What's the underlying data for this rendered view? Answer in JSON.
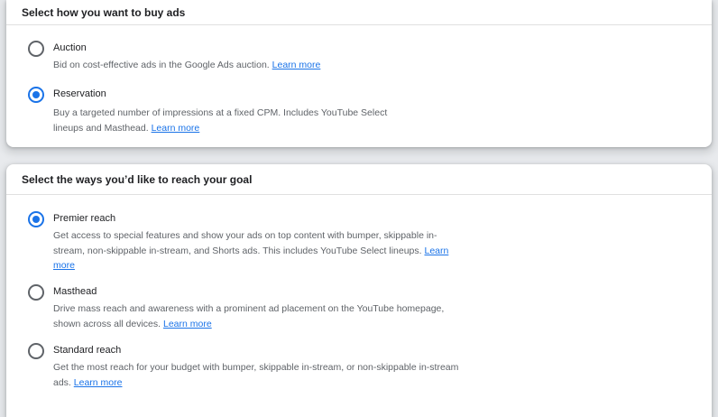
{
  "buy_section": {
    "title": "Select how you want to buy ads",
    "options": [
      {
        "label": "Auction",
        "description": "Bid on cost-effective ads in the Google Ads auction.",
        "link": "Learn more",
        "selected": false
      },
      {
        "label": "Reservation",
        "description": "Buy a targeted number of impressions at a fixed CPM. Includes YouTube Select lineups and Masthead.",
        "link": "Learn more",
        "selected": true
      }
    ]
  },
  "reach_section": {
    "title": "Select the ways you’d like to reach your goal",
    "options": [
      {
        "label": "Premier reach",
        "description": "Get access to special features and show your ads on top content with bumper, skippable in-stream, non-skippable in-stream, and Shorts ads. This includes YouTube Select lineups.",
        "link": "Learn more",
        "selected": true
      },
      {
        "label": "Masthead",
        "description": "Drive mass reach and awareness with a prominent ad placement on the YouTube homepage, shown across all devices.",
        "link": "Learn more",
        "selected": false
      },
      {
        "label": "Standard reach",
        "description": "Get the most reach for your budget with bumper, skippable in-stream, or non-skippable in-stream ads.",
        "link": "Learn more",
        "selected": false
      }
    ]
  },
  "colors": {
    "accent": "#1a73e8",
    "radio_unselected": "#5f6368",
    "description_text": "#5f6368"
  }
}
